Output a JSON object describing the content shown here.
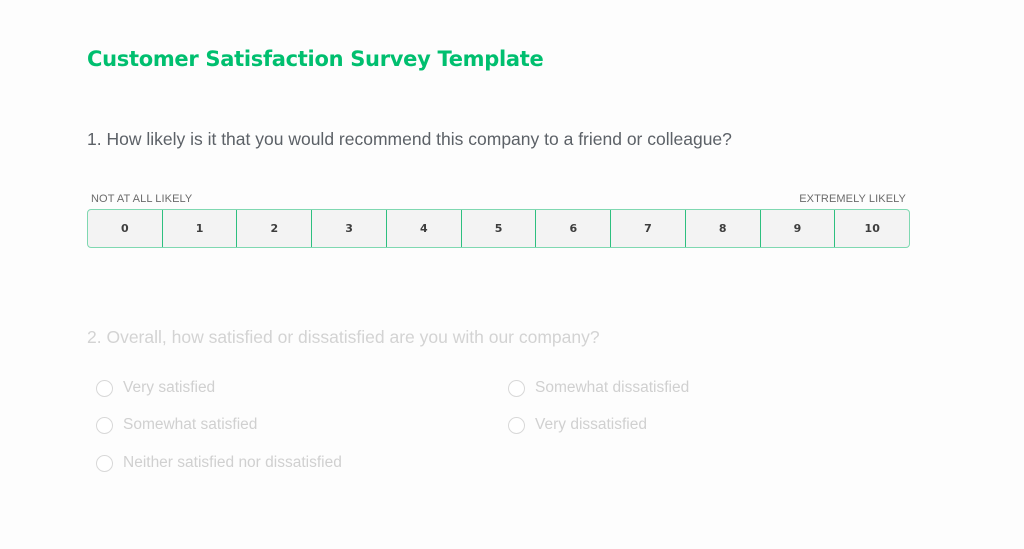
{
  "survey": {
    "title": "Customer Satisfaction Survey Template"
  },
  "colors": {
    "accent": "#00bf6f",
    "scale_border": "#7fd8b1",
    "scale_background": "#f3f3f3",
    "disabled_text": "#d0d0d0"
  },
  "question1": {
    "text": "1. How likely is it that you would recommend this company to a friend or colleague?",
    "low_label": "NOT AT ALL LIKELY",
    "high_label": "EXTREMELY LIKELY",
    "scale": [
      "0",
      "1",
      "2",
      "3",
      "4",
      "5",
      "6",
      "7",
      "8",
      "9",
      "10"
    ]
  },
  "question2": {
    "text": "2. Overall, how satisfied or dissatisfied are you with our company?",
    "options": [
      "Very satisfied",
      "Somewhat satisfied",
      "Neither satisfied nor dissatisfied",
      "Somewhat dissatisfied",
      "Very dissatisfied"
    ]
  }
}
